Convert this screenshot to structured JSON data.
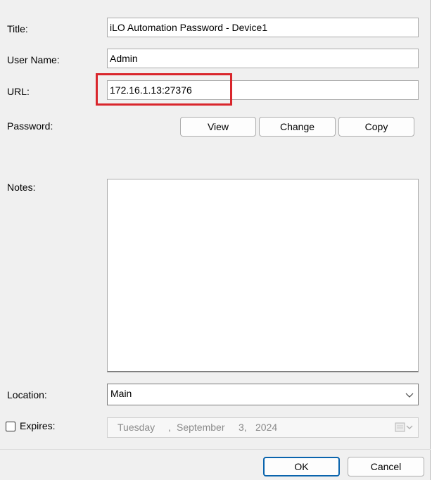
{
  "fields": {
    "title_label": "Title:",
    "title_value": "iLO Automation Password - Device1",
    "username_label": "User Name:",
    "username_value": "Admin",
    "url_label": "URL:",
    "url_value": "172.16.1.13:27376",
    "password_label": "Password:",
    "notes_label": "Notes:",
    "notes_value": "",
    "location_label": "Location:",
    "location_value": "Main",
    "expires_label": "Expires:",
    "expires_checked": false
  },
  "password_buttons": {
    "view": "View",
    "change": "Change",
    "copy": "Copy"
  },
  "expires_date": {
    "weekday": "Tuesday",
    "separator": ",",
    "month": "September",
    "day": "3,",
    "year": "2024"
  },
  "footer": {
    "ok": "OK",
    "cancel": "Cancel"
  },
  "colors": {
    "highlight": "#d9262c",
    "default_button_border": "#0a64ad",
    "dialog_background": "#f0f0f0"
  },
  "icons": {
    "combo_arrow": "chevron-down-icon",
    "date_picker": "calendar-dropdown-icon"
  }
}
